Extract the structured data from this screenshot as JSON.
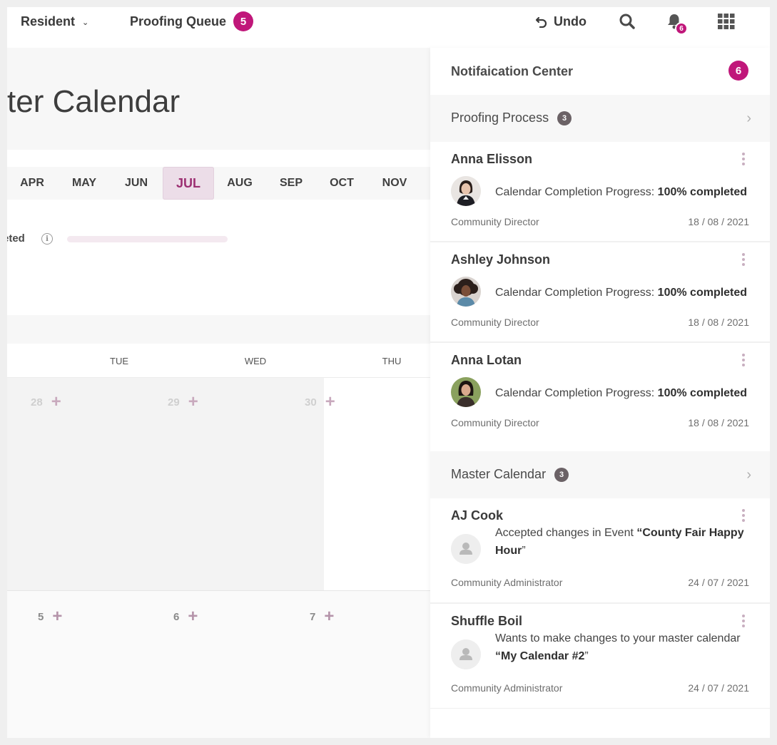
{
  "topbar": {
    "resident_label": "Resident",
    "proofing_label": "Proofing Queue",
    "proofing_count": "5",
    "undo_label": "Undo",
    "bell_count": "6"
  },
  "calendar": {
    "title": "ster Calendar",
    "months": [
      "APR",
      "MAY",
      "JUN",
      "JUL",
      "AUG",
      "SEP",
      "OCT",
      "NOV"
    ],
    "active_month": "JUL",
    "progress_label": "eted",
    "progress_value": 0,
    "days_of_week": [
      "TUE",
      "WED",
      "THU"
    ],
    "week1_days": [
      "28",
      "29",
      "30"
    ],
    "week2_days": [
      "5",
      "6",
      "7"
    ]
  },
  "panel": {
    "title": "Notifaication Center",
    "count": "6",
    "sections": [
      {
        "title": "Proofing Process",
        "count": "3",
        "items": [
          {
            "name": "Anna Elisson",
            "msg_prefix": "Calendar Completion Progress: ",
            "msg_bold": "100% completed",
            "msg_suffix": "",
            "role": "Community Director",
            "date": "18 / 08 / 2021"
          },
          {
            "name": "Ashley Johnson",
            "msg_prefix": "Calendar Completion Progress: ",
            "msg_bold": "100% completed",
            "msg_suffix": "",
            "role": "Community Director",
            "date": "18 / 08 / 2021"
          },
          {
            "name": "Anna Lotan",
            "msg_prefix": "Calendar Completion Progress: ",
            "msg_bold": "100% completed",
            "msg_suffix": "",
            "role": "Community Director",
            "date": "18 / 08 / 2021"
          }
        ]
      },
      {
        "title": "Master Calendar",
        "count": "3",
        "items": [
          {
            "name": "AJ Cook",
            "msg_prefix": "Accepted changes in Event ",
            "msg_bold": "“County Fair Happy Hour",
            "msg_suffix": "”",
            "role": "Community Administrator",
            "date": "24 / 07 / 2021"
          },
          {
            "name": "Shuffle Boil",
            "msg_prefix": "Wants to make changes to your master calendar ",
            "msg_bold": "“My Calendar #2",
            "msg_suffix": "”",
            "role": "Community Administrator",
            "date": "24 / 07 / 2021"
          }
        ]
      }
    ]
  },
  "colors": {
    "accent": "#c0177a",
    "active_month_bg": "#ecdde8",
    "active_month_text": "#9c2f72",
    "count_badge": "#6b6266"
  }
}
